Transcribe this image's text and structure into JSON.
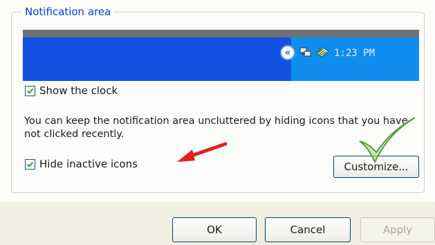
{
  "group": {
    "title": "Notification area"
  },
  "taskbar": {
    "clock": "1:23 PM"
  },
  "options": {
    "show_clock_label": "Show the clock",
    "show_clock_checked": true,
    "description": "You can keep the notification area uncluttered by hiding icons that you have not clicked recently.",
    "hide_inactive_label": "Hide inactive icons",
    "hide_inactive_checked": true
  },
  "buttons": {
    "customize": "Customize...",
    "ok": "OK",
    "cancel": "Cancel",
    "apply": "Apply"
  },
  "colors": {
    "legend": "#0046d5",
    "taskbar_blue": "#1352e0",
    "tray_blue": "#0f8ef0",
    "arrow_red": "#e32020",
    "check_green": "#7cc05a"
  }
}
